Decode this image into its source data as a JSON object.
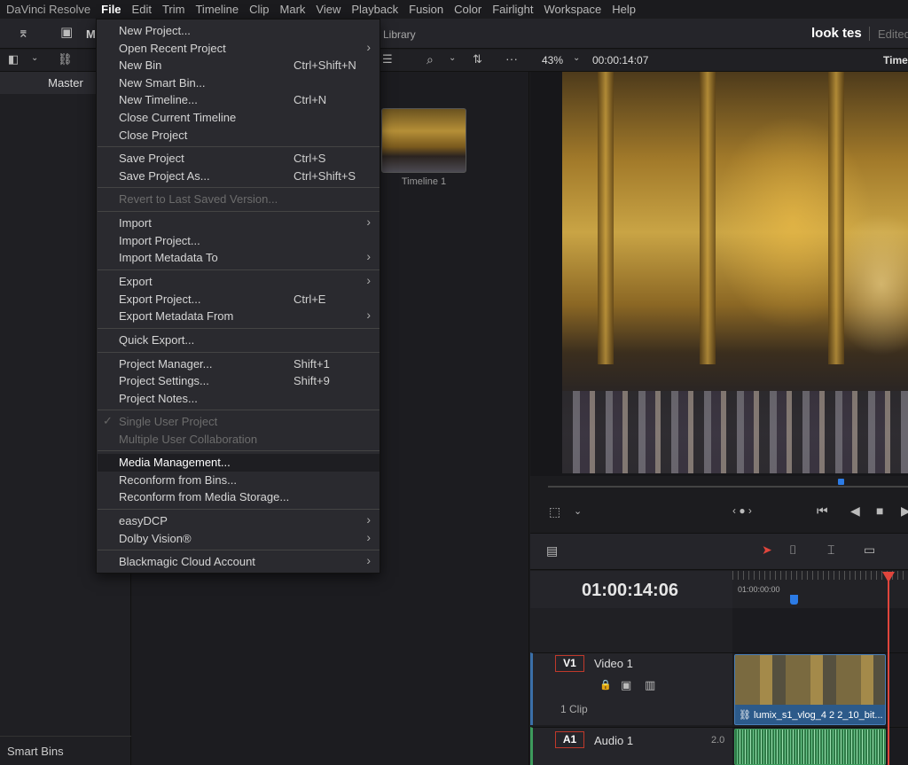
{
  "menubar": {
    "app": "DaVinci Resolve",
    "items": [
      "File",
      "Edit",
      "Trim",
      "Timeline",
      "Clip",
      "Mark",
      "View",
      "Playback",
      "Fusion",
      "Color",
      "Fairlight",
      "Workspace",
      "Help"
    ]
  },
  "toolbar": {
    "project_title": "look tes",
    "project_status": "Edited",
    "library_label": "Library",
    "media_label_partial": "M"
  },
  "subbar": {
    "zoom": "43%",
    "timecode": "00:00:14:07",
    "timeline_label": "Time"
  },
  "sidebar": {
    "master": "Master",
    "smart_bins": "Smart Bins"
  },
  "mediapool": {
    "thumb_label": "Timeline 1"
  },
  "timeline": {
    "timecode": "01:00:14:06",
    "ruler_start": "01:00:00:00",
    "video_track": {
      "badge": "V1",
      "name": "Video 1",
      "clips": "1 Clip",
      "clip_name": "lumix_s1_vlog_4 2 2_10_bit..."
    },
    "audio_track": {
      "badge": "A1",
      "name": "Audio 1",
      "level": "2.0"
    }
  },
  "file_menu": {
    "items": [
      {
        "label": "New Project...",
        "shortcut": "",
        "submenu": false,
        "disabled": false
      },
      {
        "label": "Open Recent Project",
        "shortcut": "",
        "submenu": true,
        "disabled": false
      },
      {
        "label": "New Bin",
        "shortcut": "Ctrl+Shift+N",
        "submenu": false,
        "disabled": false
      },
      {
        "label": "New Smart Bin...",
        "shortcut": "",
        "submenu": false,
        "disabled": false
      },
      {
        "label": "New Timeline...",
        "shortcut": "Ctrl+N",
        "submenu": false,
        "disabled": false
      },
      {
        "label": "Close Current Timeline",
        "shortcut": "",
        "submenu": false,
        "disabled": false
      },
      {
        "label": "Close Project",
        "shortcut": "",
        "submenu": false,
        "disabled": false
      },
      {
        "label": "Save Project",
        "shortcut": "Ctrl+S",
        "submenu": false,
        "disabled": false
      },
      {
        "label": "Save Project As...",
        "shortcut": "Ctrl+Shift+S",
        "submenu": false,
        "disabled": false
      },
      {
        "label": "Revert to Last Saved Version...",
        "shortcut": "",
        "submenu": false,
        "disabled": true
      },
      {
        "label": "Import",
        "shortcut": "",
        "submenu": true,
        "disabled": false
      },
      {
        "label": "Import Project...",
        "shortcut": "",
        "submenu": false,
        "disabled": false
      },
      {
        "label": "Import Metadata To",
        "shortcut": "",
        "submenu": true,
        "disabled": false
      },
      {
        "label": "Export",
        "shortcut": "",
        "submenu": true,
        "disabled": false
      },
      {
        "label": "Export Project...",
        "shortcut": "Ctrl+E",
        "submenu": false,
        "disabled": false
      },
      {
        "label": "Export Metadata From",
        "shortcut": "",
        "submenu": true,
        "disabled": false
      },
      {
        "label": "Quick Export...",
        "shortcut": "",
        "submenu": false,
        "disabled": false
      },
      {
        "label": "Project Manager...",
        "shortcut": "Shift+1",
        "submenu": false,
        "disabled": false
      },
      {
        "label": "Project Settings...",
        "shortcut": "Shift+9",
        "submenu": false,
        "disabled": false
      },
      {
        "label": "Project Notes...",
        "shortcut": "",
        "submenu": false,
        "disabled": false
      },
      {
        "label": "Single User Project",
        "shortcut": "",
        "submenu": false,
        "disabled": true,
        "checked": true
      },
      {
        "label": "Multiple User Collaboration",
        "shortcut": "",
        "submenu": false,
        "disabled": true
      },
      {
        "label": "Media Management...",
        "shortcut": "",
        "submenu": false,
        "disabled": false,
        "highlighted": true
      },
      {
        "label": "Reconform from Bins...",
        "shortcut": "",
        "submenu": false,
        "disabled": false
      },
      {
        "label": "Reconform from Media Storage...",
        "shortcut": "",
        "submenu": false,
        "disabled": false
      },
      {
        "label": "easyDCP",
        "shortcut": "",
        "submenu": true,
        "disabled": false
      },
      {
        "label": "Dolby Vision®",
        "shortcut": "",
        "submenu": true,
        "disabled": false
      },
      {
        "label": "Blackmagic Cloud Account",
        "shortcut": "",
        "submenu": true,
        "disabled": false
      }
    ]
  }
}
